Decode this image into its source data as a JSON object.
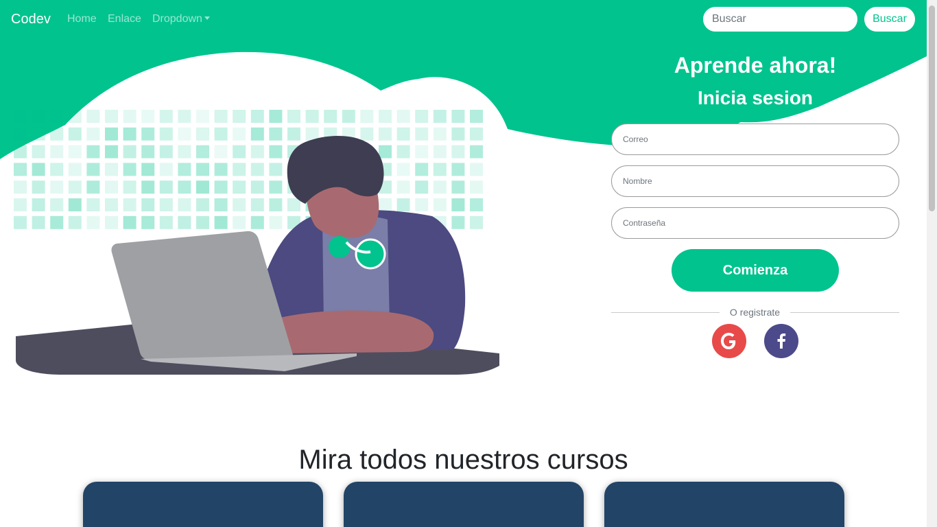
{
  "colors": {
    "accent": "#01c38e",
    "card": "#224466",
    "google": "#e84a4a",
    "facebook": "#4c4a8a"
  },
  "navbar": {
    "brand": "Codev",
    "links": [
      {
        "label": "Home"
      },
      {
        "label": "Enlace"
      },
      {
        "label": "Dropdown"
      }
    ],
    "search": {
      "placeholder": "Buscar",
      "button_label": "Buscar"
    }
  },
  "illustration": {
    "icon": "person-with-laptop-illustration"
  },
  "form": {
    "title": "Aprende ahora!",
    "subtitle": "Inicia sesion",
    "fields": [
      {
        "placeholder": "Correo"
      },
      {
        "placeholder": "Nombre"
      },
      {
        "placeholder": "Contraseña"
      }
    ],
    "submit_label": "Comienza",
    "divider_text": "O registrate",
    "social": [
      {
        "icon": "google-icon"
      },
      {
        "icon": "facebook-icon"
      }
    ]
  },
  "courses": {
    "title": "Mira todos nuestros cursos",
    "cards": [
      {},
      {},
      {}
    ]
  }
}
